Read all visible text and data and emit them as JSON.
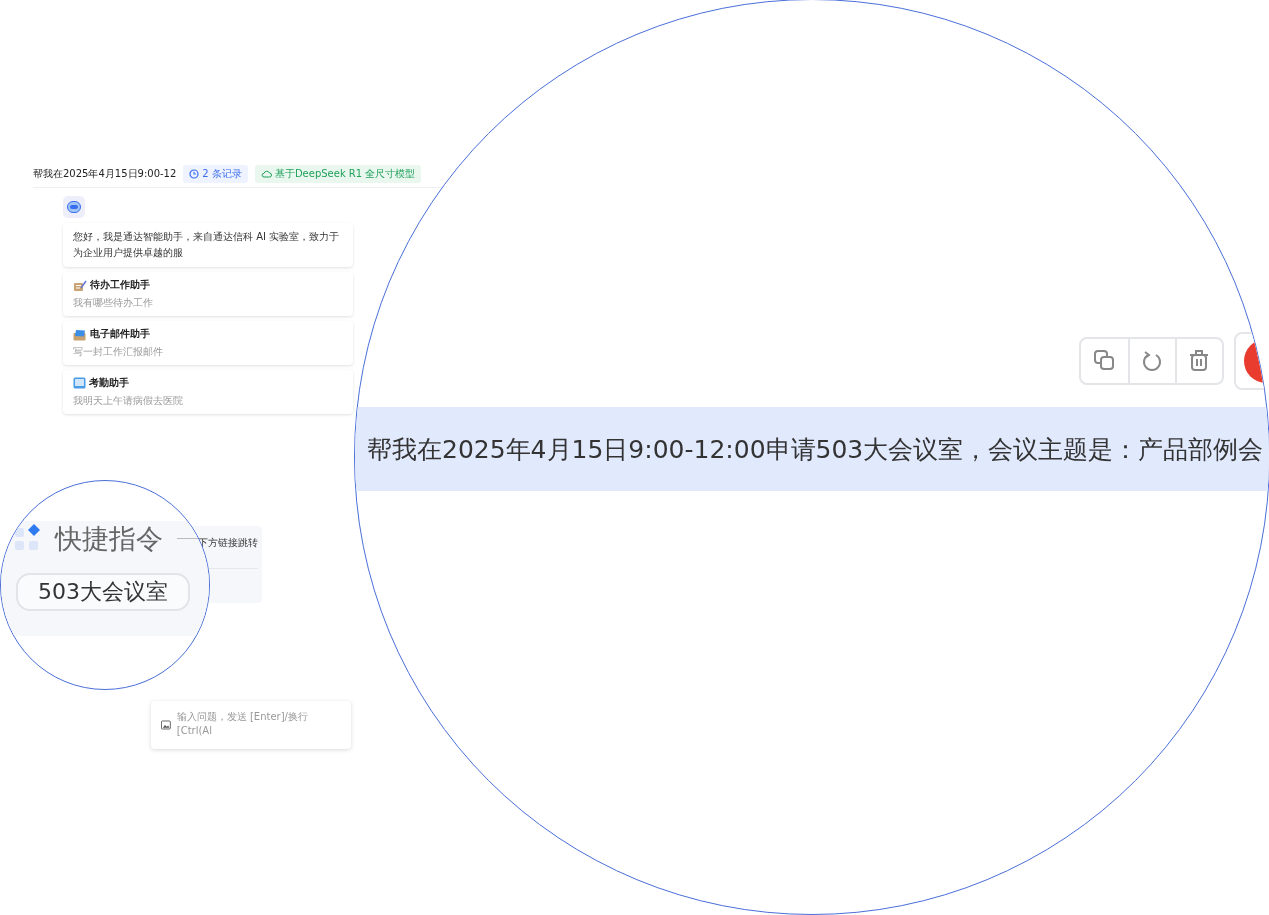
{
  "header": {
    "title": "帮我在2025年4月15日9:00-12",
    "badges": [
      {
        "kind": "records",
        "text": "2 条记录"
      },
      {
        "kind": "model",
        "text": "基于DeepSeek R1 全尺寸模型"
      }
    ]
  },
  "chat": {
    "greeting": "您好，我是通达智能助手，来自通达信科 AI 实验室，致力于为企业用户提供卓越的服",
    "assistants": [
      {
        "kind": "todo",
        "title": "待办工作助手",
        "subtitle": "我有哪些待办工作"
      },
      {
        "kind": "email",
        "title": "电子邮件助手",
        "subtitle": "写一封工作汇报邮件"
      },
      {
        "kind": "attendance",
        "title": "考勤助手",
        "subtitle": "我明天上午请病假去医院"
      }
    ]
  },
  "quick_commands": {
    "hint": "下方链接跳转"
  },
  "input": {
    "placeholder": "输入问题，发送 [Enter]/换行 [Ctrl(Al"
  },
  "magnifier_small": {
    "title": "快捷指令",
    "command": "503大会议室"
  },
  "magnifier_large": {
    "message": "帮我在2025年4月15日9:00-12:00申请503大会议室，会议主题是：产品部例会"
  }
}
